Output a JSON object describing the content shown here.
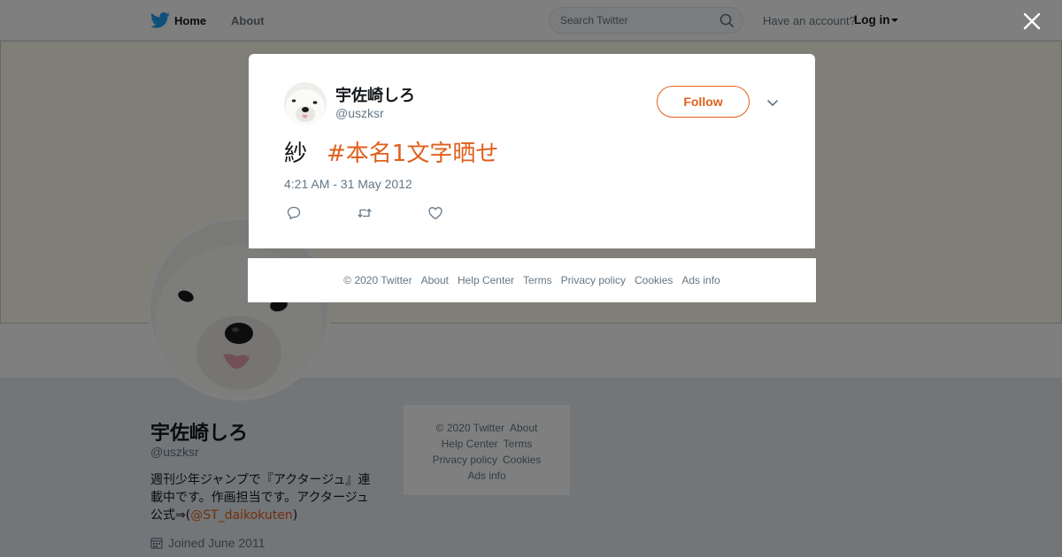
{
  "nav": {
    "home": "Home",
    "about": "About",
    "search_placeholder": "Search Twitter",
    "account_prompt": "Have an account?",
    "login": "Log in"
  },
  "profile": {
    "name": "宇佐崎しろ",
    "handle": "@uszksr",
    "bio_text": "週刊少年ジャンプで『アクタージュ』連載中です。作画担当です。アクタージュ公式⇒(",
    "bio_mention": "@ST_daikokuten",
    "bio_end": ")",
    "joined": "Joined June 2011"
  },
  "side_footer": {
    "copyright": "© 2020 Twitter",
    "about": "About",
    "help": "Help Center",
    "terms": "Terms",
    "privacy": "Privacy policy",
    "cookies": "Cookies",
    "ads": "Ads info"
  },
  "tweet": {
    "name": "宇佐崎しろ",
    "handle": "@uszksr",
    "follow_label": "Follow",
    "text": "紗",
    "hashtag": "#本名1文字晒せ",
    "timestamp": "4:21 AM - 31 May 2012"
  },
  "modal_footer": {
    "copyright": "© 2020 Twitter",
    "about": "About",
    "help": "Help Center",
    "terms": "Terms",
    "privacy": "Privacy policy",
    "cookies": "Cookies",
    "ads": "Ads info"
  },
  "colors": {
    "accent": "#e05f1c",
    "twitter_blue": "#1da1f2",
    "overlay": "rgba(0,0,0,0.5)"
  },
  "icons": [
    "twitter-logo-icon",
    "search-icon",
    "calendar-icon",
    "close-icon",
    "chevron-down-icon",
    "reply-icon",
    "retweet-icon",
    "like-icon"
  ]
}
